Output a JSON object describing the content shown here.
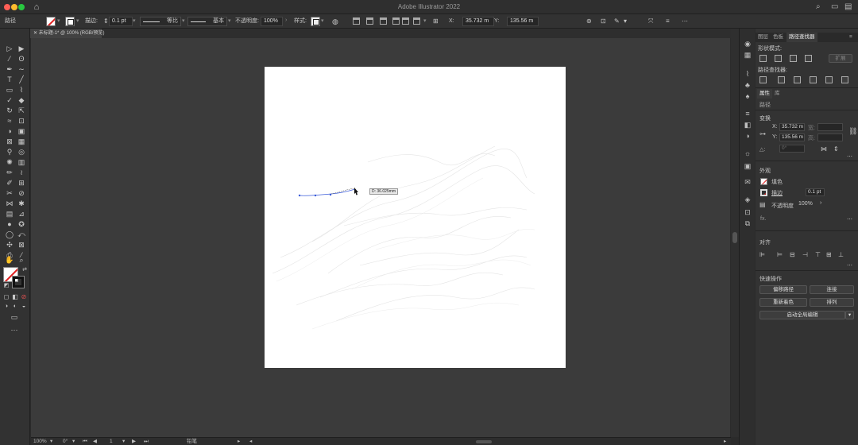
{
  "app": {
    "title": "Adobe Illustrator 2022"
  },
  "control": {
    "selection_label": "路径",
    "stroke_label": "描边:",
    "stroke_weight": "0.1 pt",
    "profile1": "等比",
    "profile2": "基本",
    "opacity_label": "不透明度:",
    "opacity_value": "100%",
    "style_label": "样式:",
    "x_label": "X:",
    "x_value": "35.732 m",
    "y_label": "Y:",
    "y_value": "135.56 m"
  },
  "document": {
    "tab_title": "未标题-1* @ 100% (RGB/预览)"
  },
  "canvas": {
    "tooltip": "D: 36.025mm"
  },
  "status": {
    "zoom": "100%",
    "rotation": "0°",
    "artboard": "1",
    "tool": "铅笔"
  },
  "panel": {
    "tabs": [
      "图层",
      "色板",
      "路径查找器"
    ],
    "shape_modes_label": "形状模式:",
    "expand_button": "扩展",
    "pathfinders_label": "路径查找器:",
    "props_tabs": [
      "属性",
      "库"
    ],
    "object_type": "路径",
    "transform_label": "变换",
    "x_label": "X:",
    "x_value": "35.732 m",
    "w_label": "宽:",
    "y_label": "Y:",
    "y_value": "135.56 m",
    "h_label": "高:",
    "angle_label": "△:",
    "angle_value": "0°",
    "appearance_label": "外观",
    "fill_label": "填色",
    "stroke_label": "描边",
    "stroke_value": "0.1 pt",
    "opacity_label": "不透明度",
    "opacity_value": "100%",
    "fx_label": "fx.",
    "align_label": "对齐",
    "quick_actions_label": "快速操作",
    "btn_offset_path": "偏移路径",
    "btn_join": "连接",
    "btn_recolor": "重新着色",
    "btn_arrange": "排列",
    "btn_start_global_edit": "启动全局编辑"
  },
  "colors": {
    "accent_path": "#3a5bd9",
    "no_fill": "#e02020",
    "artboard": "#ffffff",
    "canvas": "#3b3b3b"
  }
}
